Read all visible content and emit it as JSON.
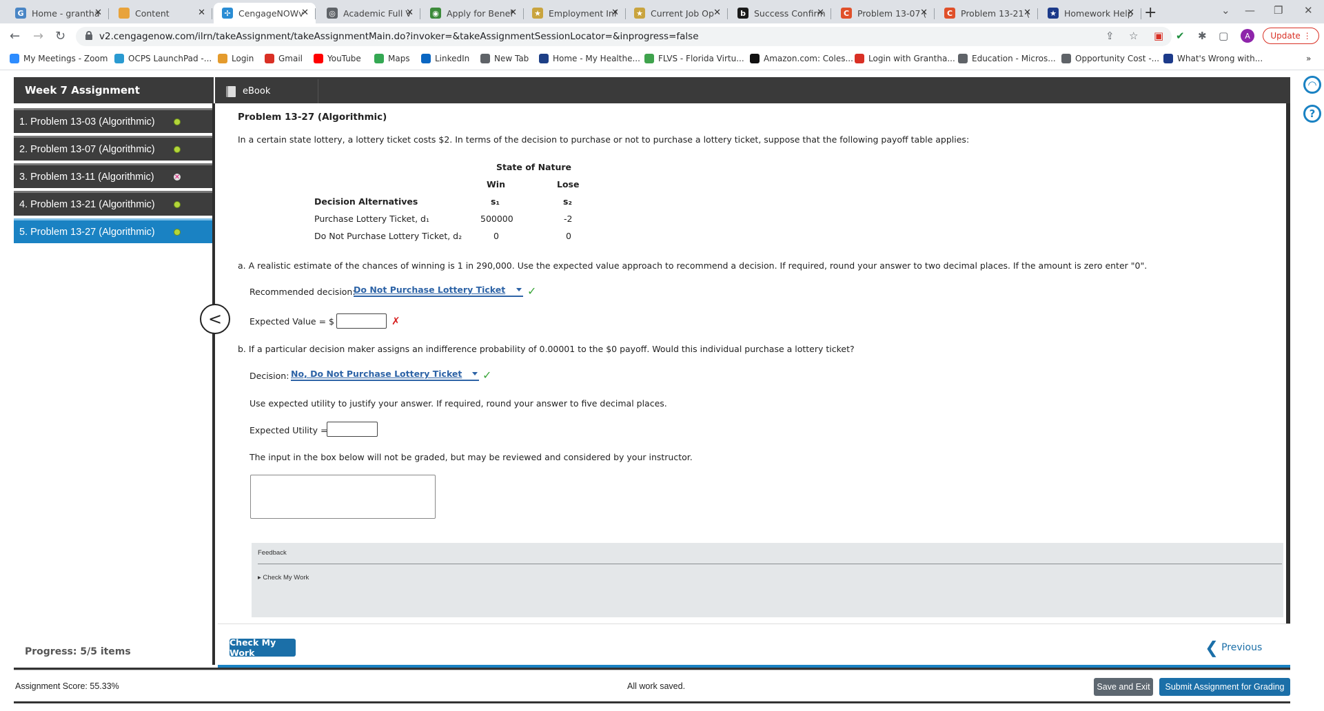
{
  "browser": {
    "tabs": [
      {
        "label": "Home - grantha",
        "color": "#4a86c5",
        "glyph": "G"
      },
      {
        "label": "Content",
        "color": "#e8a33b",
        "glyph": ""
      },
      {
        "label": "CengageNOWv",
        "color": "#2a8dd4",
        "glyph": "✢"
      },
      {
        "label": "Academic Full V",
        "color": "#5f6368",
        "glyph": "◎"
      },
      {
        "label": "Apply for Benef",
        "color": "#3c8a3a",
        "glyph": "◉"
      },
      {
        "label": "Employment Inf",
        "color": "#c9a43e",
        "glyph": "★"
      },
      {
        "label": "Current Job Op",
        "color": "#c9a43e",
        "glyph": "★"
      },
      {
        "label": "Success Confirm",
        "color": "#1a1a1a",
        "glyph": "b"
      },
      {
        "label": "Problem 13-07 (",
        "color": "#e0502a",
        "glyph": "C"
      },
      {
        "label": "Problem 13-21 (",
        "color": "#e0502a",
        "glyph": "C"
      },
      {
        "label": "Homework Help",
        "color": "#1c3a8a",
        "glyph": "★"
      }
    ],
    "url": "v2.cengagenow.com/ilrn/takeAssignment/takeAssignmentMain.do?invoker=&takeAssignmentSessionLocator=&inprogress=false",
    "profile_initial": "A",
    "update_label": "Update",
    "bookmarks": [
      {
        "label": "My Meetings - Zoom",
        "color": "#2d8cff"
      },
      {
        "label": "OCPS LaunchPad -...",
        "color": "#2a9ad1"
      },
      {
        "label": "Login",
        "color": "#e49b2d"
      },
      {
        "label": "Gmail",
        "color": "#d93025"
      },
      {
        "label": "YouTube",
        "color": "#ff0000"
      },
      {
        "label": "Maps",
        "color": "#34a853"
      },
      {
        "label": "LinkedIn",
        "color": "#0a66c2"
      },
      {
        "label": "New Tab",
        "color": "#5f6368"
      },
      {
        "label": "Home - My Healthe...",
        "color": "#1d3f86"
      },
      {
        "label": "FLVS - Florida Virtu...",
        "color": "#3fa34d"
      },
      {
        "label": "Amazon.com: Coles...",
        "color": "#111111"
      },
      {
        "label": "Login with Grantha...",
        "color": "#d93025"
      },
      {
        "label": "Education - Micros...",
        "color": "#5f6368"
      },
      {
        "label": "Opportunity Cost -...",
        "color": "#5f6368"
      },
      {
        "label": "What's Wrong with...",
        "color": "#1c3a8a"
      }
    ]
  },
  "assignment": {
    "title": "Week 7 Assignment",
    "problems": [
      {
        "label": "1. Problem 13-03 (Algorithmic)",
        "status": "ok"
      },
      {
        "label": "2. Problem 13-07 (Algorithmic)",
        "status": "ok"
      },
      {
        "label": "3. Problem 13-11 (Algorithmic)",
        "status": "bad"
      },
      {
        "label": "4. Problem 13-21 (Algorithmic)",
        "status": "ok"
      },
      {
        "label": "5. Problem 13-27 (Algorithmic)",
        "status": "ok"
      }
    ],
    "progress": "Progress: 5/5 items",
    "score": "Assignment Score:  55.33%",
    "saved_status": "All work saved."
  },
  "ebook_tab": "eBook",
  "problem": {
    "title": "Problem 13-27 (Algorithmic)",
    "intro": "In a certain state lottery, a lottery ticket costs $2. In terms of the decision to purchase or not to purchase a lottery ticket, suppose that the following payoff table applies:",
    "table": {
      "state_header": "State of Nature",
      "col_win": "Win",
      "col_lose": "Lose",
      "decision_header": "Decision Alternatives",
      "s1": "s₁",
      "s2": "s₂",
      "rows": [
        {
          "label": "Purchase Lottery Ticket, d₁",
          "win": "500000",
          "lose": "-2"
        },
        {
          "label": "Do Not Purchase Lottery Ticket, d₂",
          "win": "0",
          "lose": "0"
        }
      ]
    },
    "part_a": "a. A realistic estimate of the chances of winning is 1 in 290,000. Use the expected value approach to recommend a decision. If required, round your answer to two decimal places. If the amount is zero enter \"0\".",
    "rec_decision_label": "Recommended decision:",
    "rec_decision_value": "Do Not Purchase Lottery Ticket",
    "ev_label": "Expected Value = $",
    "ev_value": "",
    "part_b": "b. If a particular decision maker assigns an indifference probability of 0.00001 to the $0 payoff. Would this individual purchase a lottery ticket?",
    "decision_label": "Decision:",
    "decision_value": "No, Do Not Purchase Lottery Ticket",
    "utility_instruction": "Use expected utility to justify your answer. If required, round your answer to five decimal places.",
    "eu_label": "Expected Utility =",
    "eu_value": "",
    "note": "The input in the box below will not be graded, but may be reviewed and considered by your instructor.",
    "feedback_title": "Feedback",
    "feedback_check": "Check My Work"
  },
  "buttons": {
    "check_my_work": "Check My Work",
    "previous": "Previous",
    "save_exit": "Save and Exit",
    "submit": "Submit Assignment for Grading"
  }
}
